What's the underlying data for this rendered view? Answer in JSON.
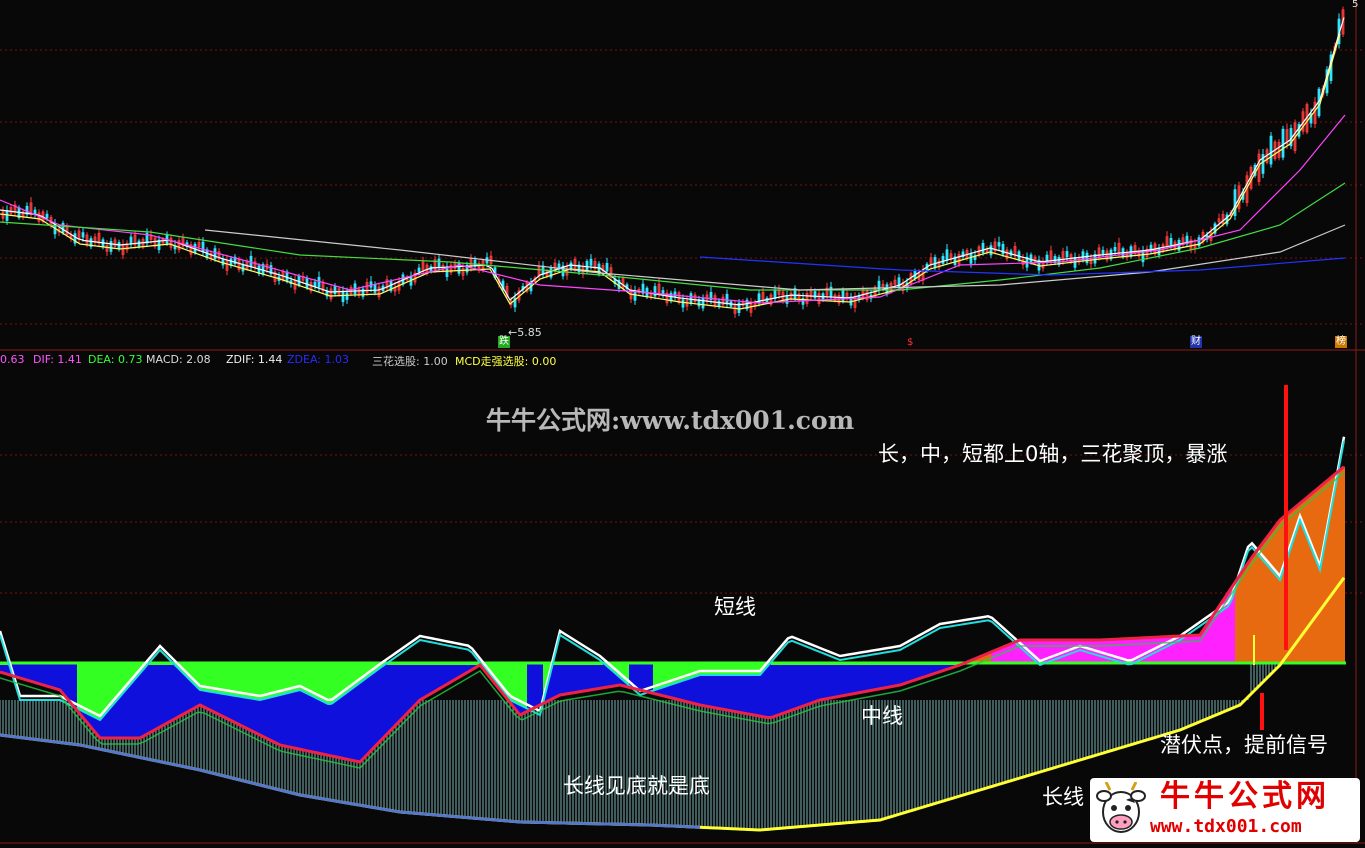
{
  "colors": {
    "background": "#080808",
    "grid": "#7a1010",
    "axis": "#8b1a1a",
    "up": "#ff3c3c",
    "down": "#2ee6ff",
    "dif": "#ff55ff",
    "dea": "#33ff33",
    "macd": "#dddddd",
    "zdif": "#eeeeee",
    "zdea": "#2222ff",
    "three_flower": "#cccccc",
    "mcd": "#ffff44",
    "ma_white": "#ffffff",
    "ma_yellow": "#ffff66",
    "ma_magenta": "#ff44ff",
    "ma_green": "#44dd44",
    "ma_blue": "#2233ff",
    "ma_gray": "#cccccc"
  },
  "price_panel": {
    "low_marker": "5.85",
    "low_arrow": "←",
    "top_right_value": "5",
    "badges": [
      {
        "label": "跌",
        "color": "#22cc22"
      },
      {
        "label": "$",
        "color": "#ff3333"
      },
      {
        "label": "财",
        "color": "#3344ff"
      },
      {
        "label": "榜",
        "color": "#dd8800"
      }
    ]
  },
  "indicator_header": {
    "first_value": "0.63",
    "dif_label": "DIF: 1.41",
    "dea_label": "DEA: 0.73",
    "macd_label": "MACD: 2.08",
    "zdif_label": "ZDIF: 1.44",
    "zdea_label": "ZDEA: 1.03",
    "three_label": "三花选股: 1.00",
    "mcd_label": "MCD走强选股: 0.00"
  },
  "annotations": {
    "watermark": "牛牛公式网:www.tdx001.com",
    "top_right": "长，中，短都上0轴，三花聚顶，暴涨",
    "short_line": "短线",
    "mid_line": "中线",
    "long_bottom": "长线见底就是底",
    "ambush": "潜伏点，提前信号",
    "long_line": "长线"
  },
  "logo": {
    "name": "牛牛公式网",
    "url": "www.tdx001.com"
  },
  "chart_data": {
    "type": "line",
    "title": "",
    "series": [
      {
        "name": "DIF",
        "values": []
      },
      {
        "name": "DEA",
        "values": []
      },
      {
        "name": "MACD",
        "values": []
      },
      {
        "name": "ZDIF",
        "values": []
      },
      {
        "name": "ZDEA",
        "values": []
      }
    ],
    "y_label": "",
    "x_label": ""
  }
}
